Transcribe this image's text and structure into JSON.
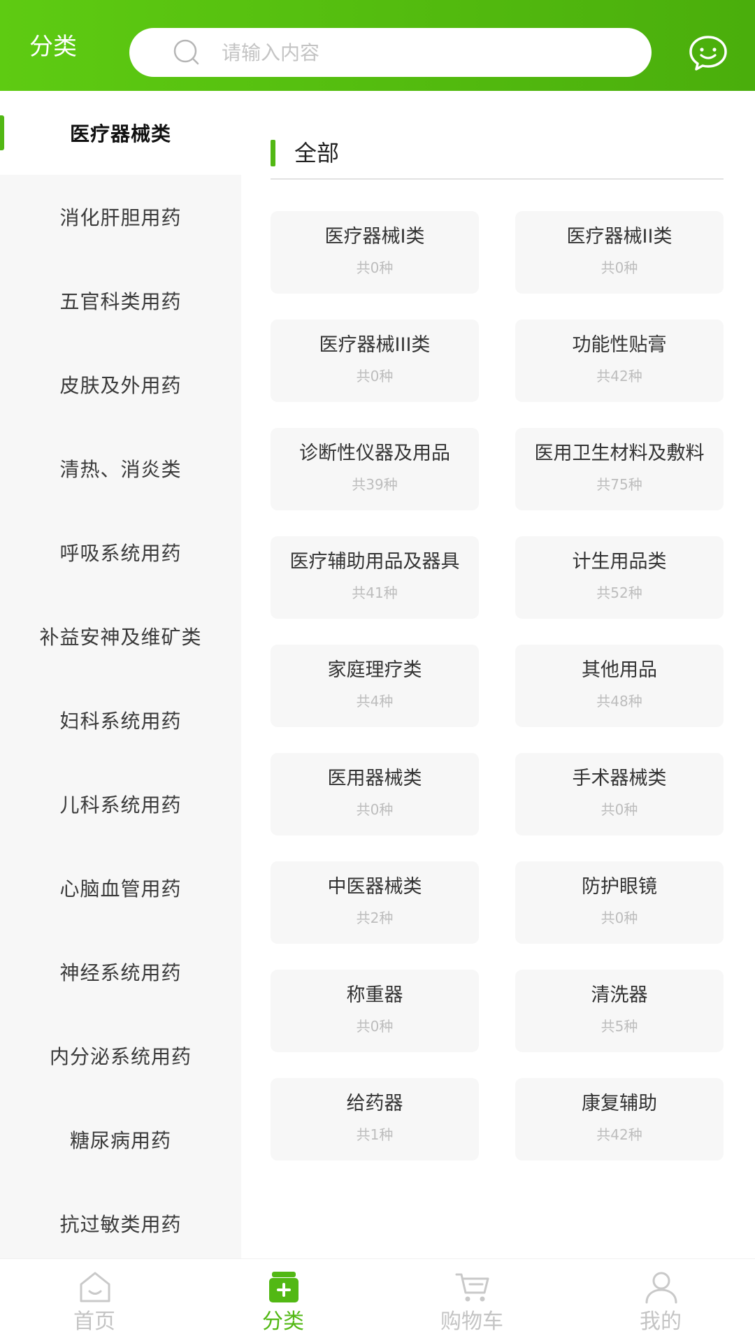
{
  "header": {
    "title": "分类",
    "search_placeholder": "请输入内容"
  },
  "sidebar": {
    "items": [
      {
        "label": "医疗器械类",
        "active": true
      },
      {
        "label": "消化肝胆用药"
      },
      {
        "label": "五官科类用药"
      },
      {
        "label": "皮肤及外用药"
      },
      {
        "label": "清热、消炎类"
      },
      {
        "label": "呼吸系统用药"
      },
      {
        "label": "补益安神及维矿类"
      },
      {
        "label": "妇科系统用药"
      },
      {
        "label": "儿科系统用药"
      },
      {
        "label": "心脑血管用药"
      },
      {
        "label": "神经系统用药"
      },
      {
        "label": "内分泌系统用药"
      },
      {
        "label": "糖尿病用药"
      },
      {
        "label": "抗过敏类用药"
      }
    ]
  },
  "section": {
    "title": "全部"
  },
  "categories": [
    {
      "name": "医疗器械I类",
      "count": "共0种"
    },
    {
      "name": "医疗器械II类",
      "count": "共0种"
    },
    {
      "name": "医疗器械III类",
      "count": "共0种"
    },
    {
      "name": "功能性贴膏",
      "count": "共42种"
    },
    {
      "name": "诊断性仪器及用品",
      "count": "共39种"
    },
    {
      "name": "医用卫生材料及敷料",
      "count": "共75种"
    },
    {
      "name": "医疗辅助用品及器具",
      "count": "共41种"
    },
    {
      "name": "计生用品类",
      "count": "共52种"
    },
    {
      "name": "家庭理疗类",
      "count": "共4种"
    },
    {
      "name": "其他用品",
      "count": "共48种"
    },
    {
      "name": "医用器械类",
      "count": "共0种"
    },
    {
      "name": "手术器械类",
      "count": "共0种"
    },
    {
      "name": "中医器械类",
      "count": "共2种"
    },
    {
      "name": "防护眼镜",
      "count": "共0种"
    },
    {
      "name": "称重器",
      "count": "共0种"
    },
    {
      "name": "清洗器",
      "count": "共5种"
    },
    {
      "name": "给药器",
      "count": "共1种"
    },
    {
      "name": "康复辅助",
      "count": "共42种"
    }
  ],
  "tabbar": {
    "tabs": [
      {
        "label": "首页",
        "icon": "home-icon"
      },
      {
        "label": "分类",
        "icon": "category-icon",
        "active": true
      },
      {
        "label": "购物车",
        "icon": "cart-icon"
      },
      {
        "label": "我的",
        "icon": "profile-icon"
      }
    ]
  },
  "colors": {
    "accent": "#52b814",
    "header_start": "#5ecb12",
    "header_end": "#4aae0c"
  }
}
